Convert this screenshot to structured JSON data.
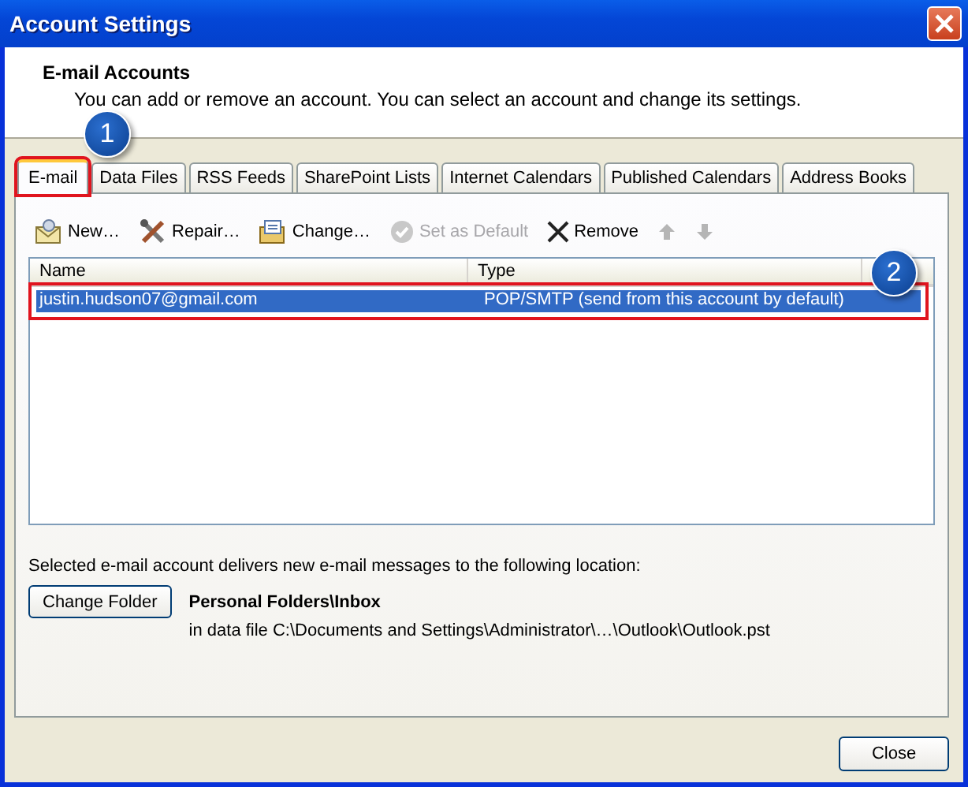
{
  "window": {
    "title": "Account Settings"
  },
  "header": {
    "title": "E-mail Accounts",
    "description": "You can add or remove an account. You can select an account and change its settings."
  },
  "tabs": [
    {
      "label": "E-mail",
      "selected": true,
      "highlighted": true,
      "callout": "1"
    },
    {
      "label": "Data Files",
      "selected": false,
      "highlighted": false
    },
    {
      "label": "RSS Feeds",
      "selected": false,
      "highlighted": false
    },
    {
      "label": "SharePoint Lists",
      "selected": false,
      "highlighted": false
    },
    {
      "label": "Internet Calendars",
      "selected": false,
      "highlighted": false
    },
    {
      "label": "Published Calendars",
      "selected": false,
      "highlighted": false
    },
    {
      "label": "Address Books",
      "selected": false,
      "highlighted": false
    }
  ],
  "toolbar": [
    {
      "kind": "new",
      "label": "New…",
      "disabled": false
    },
    {
      "kind": "repair",
      "label": "Repair…",
      "disabled": false
    },
    {
      "kind": "change",
      "label": "Change…",
      "disabled": false
    },
    {
      "kind": "default",
      "label": "Set as Default",
      "disabled": true
    },
    {
      "kind": "remove",
      "label": "Remove",
      "disabled": false
    },
    {
      "kind": "up",
      "disabled": true
    },
    {
      "kind": "down",
      "disabled": true
    }
  ],
  "accounts": {
    "columns": [
      "Name",
      "Type"
    ],
    "rows": [
      {
        "name": "justin.hudson07@gmail.com",
        "type": "POP/SMTP (send from this account by default)",
        "selected": true,
        "highlighted": true,
        "callout": "2"
      }
    ]
  },
  "delivery": {
    "text": "Selected e-mail account delivers new e-mail messages to the following location:",
    "button": "Change Folder",
    "folder": "Personal Folders\\Inbox",
    "path": "in data file C:\\Documents and Settings\\Administrator\\…\\Outlook\\Outlook.pst"
  },
  "buttons": [
    "Close"
  ]
}
